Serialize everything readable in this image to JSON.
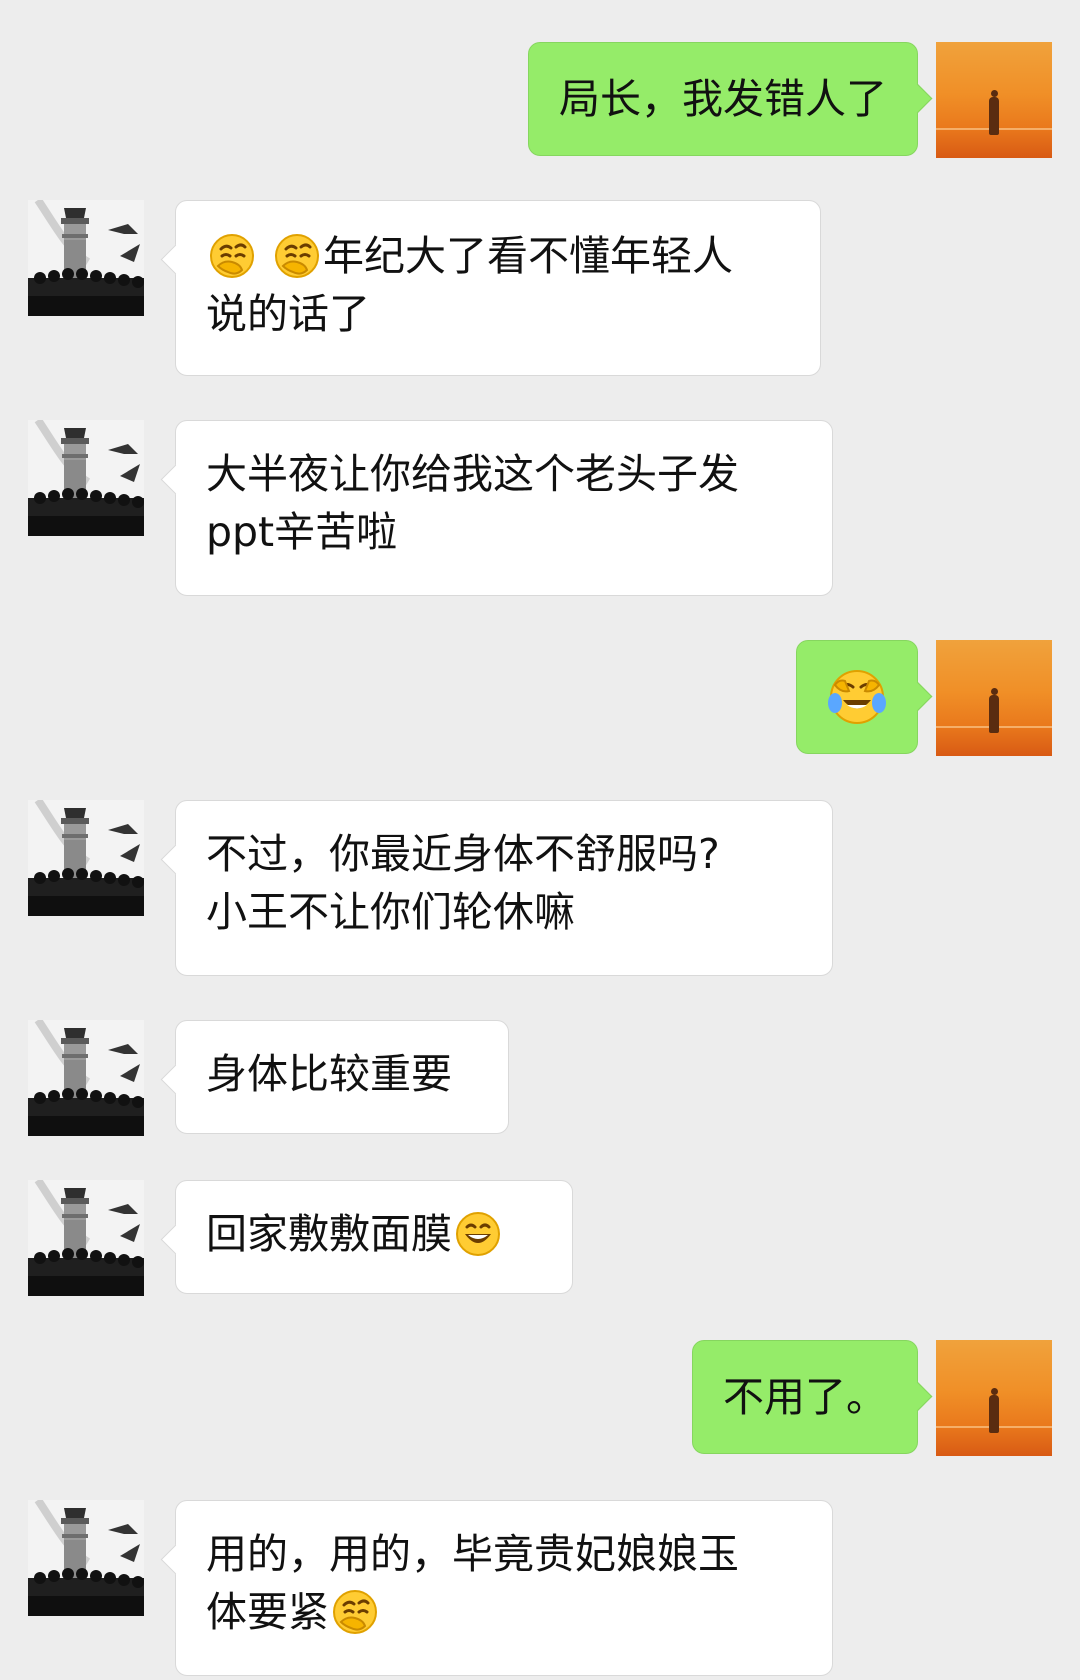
{
  "conversation": {
    "messages": [
      {
        "side": "out",
        "text": "局长，我发错人了"
      },
      {
        "side": "in",
        "emoji_before": [
          "thinking-hand-face",
          "thinking-hand-face"
        ],
        "text_line1": "年纪大了看不懂年轻人",
        "text_line2": "说的话了"
      },
      {
        "side": "in",
        "text_line1": "大半夜让你给我这个老头子发",
        "text_line2": "ppt辛苦啦"
      },
      {
        "side": "out",
        "emoji": "crying-laughing-face"
      },
      {
        "side": "in",
        "text_line1": "不过，你最近身体不舒服吗?",
        "text_line2": "小王不让你们轮休嘛"
      },
      {
        "side": "in",
        "text": "身体比较重要"
      },
      {
        "side": "in",
        "text": "回家敷敷面膜",
        "emoji_after": "grinning-face"
      },
      {
        "side": "out",
        "text": "不用了。"
      },
      {
        "side": "in",
        "text_line1": "用的，用的，毕竟贵妃娘娘玉",
        "text_line2": "体要紧",
        "emoji_after": "thinking-hand-face"
      }
    ]
  },
  "colors": {
    "background": "#ededed",
    "incoming_bubble": "#ffffff",
    "outgoing_bubble": "#95ec69"
  },
  "avatars": {
    "self": "sunset-silhouette-avatar",
    "contact": "honor-guard-column-avatar"
  }
}
